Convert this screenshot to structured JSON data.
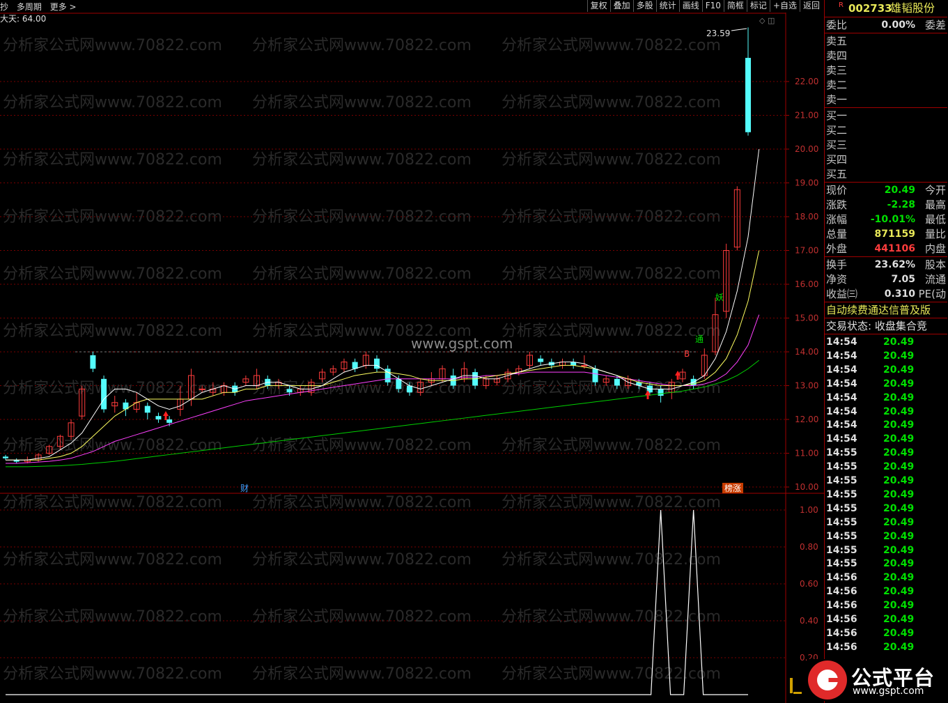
{
  "toolbar": {
    "left_items": [
      "抄",
      "多周期",
      "更多 >"
    ],
    "buttons": [
      "复权",
      "叠加",
      "多股",
      "统计",
      "画线",
      "F10",
      "简框",
      "标记",
      "+自选",
      "返回"
    ]
  },
  "chart": {
    "indicator_label": "大天: 64.00",
    "max_label": "23.59",
    "watermark_top": "www.gspt.com",
    "watermark_text": "分析家公式网www.70822.com",
    "marker_cai": "财",
    "marker_bangzhang": "榜涨",
    "marker_yao": "妖",
    "marker_tong": "通",
    "marker_B": "B",
    "price_axis_labels": [
      "22.00",
      "21.00",
      "20.00",
      "19.00",
      "18.00",
      "17.00",
      "16.00",
      "15.00",
      "14.00",
      "13.00",
      "12.00",
      "11.00",
      "10.00"
    ],
    "sub_axis_labels": [
      "1.00",
      "0.80",
      "0.60",
      "0.40",
      "0.20"
    ],
    "colors": {
      "up": "#ff3c3c",
      "down": "#54fcfc",
      "ma5": "#ffffff",
      "ma10": "#ffff60",
      "ma20": "#ff40ff",
      "ma60": "#00d000",
      "grid": "#7a0000"
    }
  },
  "chart_data": {
    "type": "candlestick",
    "price_range": [
      10.0,
      23.59
    ],
    "candles": [
      [
        10.9,
        10.85,
        10.8,
        10.95
      ],
      [
        10.8,
        10.75,
        10.7,
        10.85
      ],
      [
        10.75,
        10.8,
        10.7,
        10.9
      ],
      [
        10.8,
        10.95,
        10.75,
        11.0
      ],
      [
        11.0,
        11.2,
        10.95,
        11.25
      ],
      [
        11.2,
        11.5,
        11.1,
        11.55
      ],
      [
        11.5,
        11.9,
        11.4,
        12.0
      ],
      [
        12.1,
        12.9,
        12.0,
        13.0
      ],
      [
        13.9,
        13.5,
        13.4,
        14.0
      ],
      [
        13.2,
        12.3,
        12.2,
        13.3
      ],
      [
        12.4,
        12.5,
        12.2,
        12.7
      ],
      [
        12.5,
        12.3,
        12.1,
        12.6
      ],
      [
        12.3,
        12.5,
        12.2,
        12.8
      ],
      [
        12.4,
        12.2,
        12.0,
        12.5
      ],
      [
        12.1,
        12.0,
        11.9,
        12.2
      ],
      [
        12.0,
        11.9,
        11.8,
        12.1
      ],
      [
        12.3,
        12.6,
        12.1,
        13.0
      ],
      [
        12.6,
        13.3,
        12.4,
        13.5
      ],
      [
        12.9,
        12.9,
        12.8,
        13.0
      ],
      [
        12.8,
        12.9,
        12.7,
        13.1
      ],
      [
        12.8,
        13.0,
        12.7,
        13.1
      ],
      [
        13.0,
        12.8,
        12.7,
        13.1
      ],
      [
        13.1,
        13.2,
        13.0,
        13.3
      ],
      [
        13.0,
        13.3,
        12.9,
        13.5
      ],
      [
        13.2,
        13.0,
        12.9,
        13.3
      ],
      [
        13.0,
        13.1,
        12.9,
        13.2
      ],
      [
        12.9,
        12.8,
        12.7,
        13.0
      ],
      [
        12.8,
        12.9,
        12.7,
        13.0
      ],
      [
        12.8,
        13.1,
        12.7,
        13.2
      ],
      [
        13.2,
        13.4,
        13.1,
        13.5
      ],
      [
        13.4,
        13.5,
        13.3,
        13.6
      ],
      [
        13.5,
        13.7,
        13.4,
        13.8
      ],
      [
        13.7,
        13.5,
        13.4,
        13.8
      ],
      [
        13.6,
        13.9,
        13.5,
        14.0
      ],
      [
        13.8,
        13.5,
        13.4,
        13.9
      ],
      [
        13.5,
        13.1,
        13.0,
        13.6
      ],
      [
        13.2,
        12.9,
        12.8,
        13.3
      ],
      [
        13.0,
        12.8,
        12.7,
        13.1
      ],
      [
        12.8,
        13.1,
        12.7,
        13.2
      ],
      [
        13.1,
        13.2,
        13.0,
        13.4
      ],
      [
        13.2,
        13.5,
        13.1,
        13.6
      ],
      [
        13.3,
        13.0,
        12.9,
        13.5
      ],
      [
        13.2,
        13.5,
        13.1,
        13.7
      ],
      [
        13.4,
        13.0,
        12.9,
        13.5
      ],
      [
        13.0,
        13.2,
        12.9,
        13.3
      ],
      [
        13.1,
        13.2,
        13.0,
        13.3
      ],
      [
        13.2,
        13.4,
        13.1,
        13.5
      ],
      [
        13.4,
        13.5,
        13.3,
        13.6
      ],
      [
        13.6,
        13.9,
        13.5,
        14.0
      ],
      [
        13.8,
        13.7,
        13.6,
        13.9
      ],
      [
        13.7,
        13.6,
        13.5,
        13.8
      ],
      [
        13.6,
        13.7,
        13.5,
        13.8
      ],
      [
        13.7,
        13.6,
        13.5,
        13.8
      ],
      [
        13.6,
        13.6,
        13.5,
        13.9
      ],
      [
        13.5,
        13.1,
        13.0,
        13.6
      ],
      [
        13.1,
        13.2,
        13.0,
        13.3
      ],
      [
        13.2,
        13.0,
        12.9,
        13.3
      ],
      [
        13.0,
        13.2,
        12.9,
        13.3
      ],
      [
        13.1,
        13.0,
        12.9,
        13.2
      ],
      [
        13.0,
        12.8,
        12.7,
        13.1
      ],
      [
        12.9,
        12.7,
        12.5,
        13.0
      ],
      [
        12.8,
        13.1,
        12.6,
        13.2
      ],
      [
        13.2,
        13.4,
        13.1,
        13.5
      ],
      [
        13.2,
        13.0,
        12.9,
        13.3
      ],
      [
        13.3,
        13.9,
        13.2,
        14.1
      ],
      [
        14.0,
        15.1,
        13.9,
        15.6
      ],
      [
        15.2,
        17.0,
        15.0,
        17.2
      ],
      [
        17.1,
        18.8,
        17.0,
        18.9
      ],
      [
        22.7,
        20.5,
        20.4,
        23.6
      ]
    ],
    "ma5": [
      10.8,
      10.8,
      10.8,
      10.85,
      10.9,
      11.1,
      11.3,
      11.6,
      12.1,
      12.6,
      12.9,
      12.9,
      12.8,
      12.6,
      12.4,
      12.3,
      12.4,
      12.6,
      12.8,
      12.9,
      13.0,
      12.9,
      13.0,
      13.0,
      13.1,
      13.1,
      13.0,
      12.9,
      12.9,
      13.0,
      13.2,
      13.4,
      13.5,
      13.6,
      13.6,
      13.4,
      13.2,
      13.0,
      12.9,
      13.0,
      13.1,
      13.2,
      13.3,
      13.3,
      13.2,
      13.2,
      13.3,
      13.4,
      13.5,
      13.6,
      13.65,
      13.7,
      13.7,
      13.65,
      13.5,
      13.4,
      13.3,
      13.1,
      13.0,
      12.9,
      12.9,
      12.9,
      13.0,
      13.1,
      13.3,
      13.8,
      14.6,
      15.8,
      17.4,
      20.0
    ],
    "ma10": [
      10.8,
      10.8,
      10.8,
      10.8,
      10.85,
      10.9,
      11.0,
      11.2,
      11.5,
      11.8,
      12.1,
      12.3,
      12.5,
      12.6,
      12.6,
      12.6,
      12.6,
      12.6,
      12.6,
      12.7,
      12.8,
      12.8,
      12.9,
      12.9,
      13.0,
      13.0,
      13.0,
      13.0,
      13.0,
      13.0,
      13.1,
      13.2,
      13.3,
      13.35,
      13.4,
      13.4,
      13.35,
      13.3,
      13.2,
      13.15,
      13.15,
      13.15,
      13.2,
      13.2,
      13.25,
      13.3,
      13.35,
      13.4,
      13.45,
      13.5,
      13.55,
      13.6,
      13.6,
      13.55,
      13.5,
      13.4,
      13.3,
      13.2,
      13.1,
      13.05,
      13.0,
      13.0,
      13.0,
      13.05,
      13.15,
      13.4,
      13.8,
      14.5,
      15.5,
      17.0
    ],
    "ma20": [
      10.7,
      10.7,
      10.72,
      10.74,
      10.76,
      10.8,
      10.85,
      10.95,
      11.05,
      11.2,
      11.35,
      11.45,
      11.55,
      11.65,
      11.75,
      11.85,
      11.95,
      12.05,
      12.15,
      12.25,
      12.35,
      12.45,
      12.55,
      12.6,
      12.65,
      12.7,
      12.75,
      12.8,
      12.85,
      12.9,
      12.95,
      13.0,
      13.05,
      13.1,
      13.15,
      13.2,
      13.2,
      13.2,
      13.2,
      13.2,
      13.2,
      13.2,
      13.25,
      13.25,
      13.3,
      13.3,
      13.35,
      13.35,
      13.4,
      13.4,
      13.4,
      13.4,
      13.4,
      13.4,
      13.35,
      13.3,
      13.25,
      13.2,
      13.15,
      13.1,
      13.05,
      13.0,
      13.0,
      13.0,
      13.05,
      13.15,
      13.35,
      13.7,
      14.2,
      15.1
    ],
    "ma60": [
      10.6,
      10.6,
      10.6,
      10.61,
      10.62,
      10.63,
      10.65,
      10.67,
      10.7,
      10.73,
      10.76,
      10.8,
      10.84,
      10.88,
      10.92,
      10.96,
      11.0,
      11.04,
      11.08,
      11.12,
      11.16,
      11.2,
      11.24,
      11.28,
      11.32,
      11.36,
      11.4,
      11.44,
      11.48,
      11.52,
      11.56,
      11.6,
      11.64,
      11.68,
      11.72,
      11.76,
      11.8,
      11.84,
      11.88,
      11.92,
      11.96,
      12.0,
      12.04,
      12.08,
      12.12,
      12.16,
      12.2,
      12.24,
      12.28,
      12.32,
      12.36,
      12.4,
      12.44,
      12.48,
      12.52,
      12.56,
      12.6,
      12.64,
      12.68,
      12.72,
      12.76,
      12.8,
      12.84,
      12.9,
      12.96,
      13.05,
      13.15,
      13.3,
      13.5,
      13.75
    ],
    "sub_signal": [
      0,
      0,
      0,
      0,
      0,
      0,
      0,
      0,
      0,
      0,
      0,
      0,
      0,
      0,
      0,
      0,
      0,
      0,
      0,
      0,
      0,
      0,
      0,
      0,
      0,
      0,
      0,
      0,
      0,
      0,
      0,
      0,
      0,
      0,
      0,
      0,
      0,
      0,
      0,
      0,
      0,
      0,
      0,
      0,
      0,
      0,
      0,
      0,
      0,
      0,
      0,
      0,
      0,
      0,
      0,
      0,
      0,
      0,
      0,
      0,
      1,
      0,
      0,
      1,
      0,
      0,
      0,
      0,
      0,
      0
    ]
  },
  "panel": {
    "code": "002733",
    "name": "雄韬股份",
    "r_flag": "R",
    "weibi_label": "委比",
    "weibi_value": "0.00%",
    "weicha_label": "委差",
    "sells": [
      "卖五",
      "卖四",
      "卖三",
      "卖二",
      "卖一"
    ],
    "buys": [
      "买一",
      "买二",
      "买三",
      "买四",
      "买五"
    ],
    "stats": [
      {
        "l": "现价",
        "v": "20.49",
        "c": "#00e000",
        "r": "今开"
      },
      {
        "l": "涨跌",
        "v": "-2.28",
        "c": "#00e000",
        "r": "最高"
      },
      {
        "l": "涨幅",
        "v": "-10.01%",
        "c": "#00e000",
        "r": "最低"
      },
      {
        "l": "总量",
        "v": "871159",
        "c": "#e8e858",
        "r": "量比"
      },
      {
        "l": "外盘",
        "v": "441106",
        "c": "#ff3c3c",
        "r": "内盘"
      }
    ],
    "stats2": [
      {
        "l": "换手",
        "v": "23.62%",
        "c": "#e0e0e0",
        "r": "股本"
      },
      {
        "l": "净资",
        "v": "7.05",
        "c": "#e0e0e0",
        "r": "流通"
      },
      {
        "l": "收益㈢",
        "v": "0.310",
        "c": "#e0e0e0",
        "r": "PE(动"
      }
    ],
    "ticker_text": "自动续费通达信普及版",
    "status_text": "交易状态: 收盘集合竞",
    "ticks": [
      {
        "t": "14:54",
        "p": "20.49"
      },
      {
        "t": "14:54",
        "p": "20.49"
      },
      {
        "t": "14:54",
        "p": "20.49"
      },
      {
        "t": "14:54",
        "p": "20.49"
      },
      {
        "t": "14:54",
        "p": "20.49"
      },
      {
        "t": "14:54",
        "p": "20.49"
      },
      {
        "t": "14:54",
        "p": "20.49"
      },
      {
        "t": "14:54",
        "p": "20.49"
      },
      {
        "t": "14:55",
        "p": "20.49"
      },
      {
        "t": "14:55",
        "p": "20.49"
      },
      {
        "t": "14:55",
        "p": "20.49"
      },
      {
        "t": "14:55",
        "p": "20.49"
      },
      {
        "t": "14:55",
        "p": "20.49"
      },
      {
        "t": "14:55",
        "p": "20.49"
      },
      {
        "t": "14:55",
        "p": "20.49"
      },
      {
        "t": "14:55",
        "p": "20.49"
      },
      {
        "t": "14:55",
        "p": "20.49"
      },
      {
        "t": "14:56",
        "p": "20.49"
      },
      {
        "t": "14:56",
        "p": "20.49"
      },
      {
        "t": "14:56",
        "p": "20.49"
      },
      {
        "t": "14:56",
        "p": "20.49"
      },
      {
        "t": "14:56",
        "p": "20.49"
      },
      {
        "t": "14:56",
        "p": "20.49"
      }
    ]
  },
  "logo": {
    "title": "公式平台",
    "url": "www.gspt.com"
  }
}
